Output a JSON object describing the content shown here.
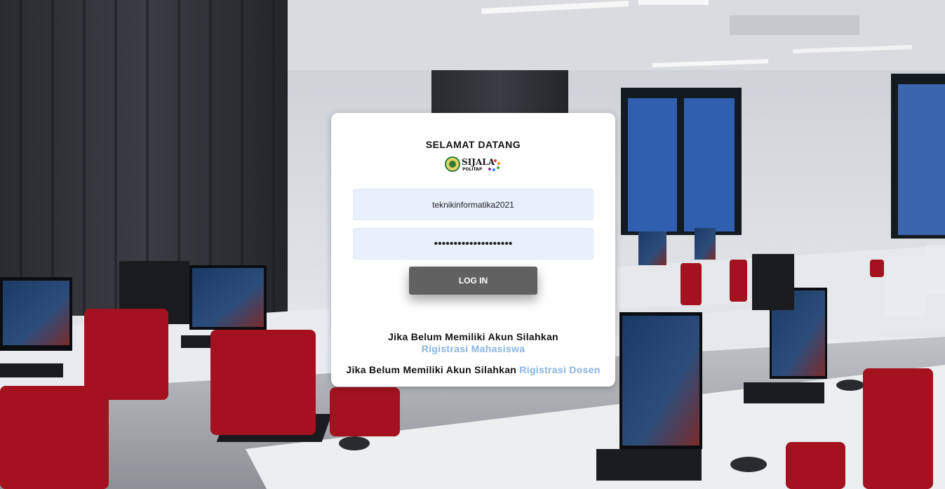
{
  "login": {
    "welcome": "SELAMAT DATANG",
    "logo_text": "SIJALA",
    "logo_subtext": "POLITAP",
    "username_value": "teknikinformatika2021",
    "password_value": "••••••••••••••••••••",
    "login_label": "LOG IN",
    "register_prompt": "Jika Belum Memiliki Akun Silahkan",
    "register_student_link": "Rigistrasi Mahasiswa",
    "register_lecturer_link": "Rigistrasi Dosen"
  },
  "colors": {
    "card": "#ffffff",
    "input_bg": "#e8f0fe",
    "button_bg": "#616161",
    "link": "#8ab4e0"
  }
}
